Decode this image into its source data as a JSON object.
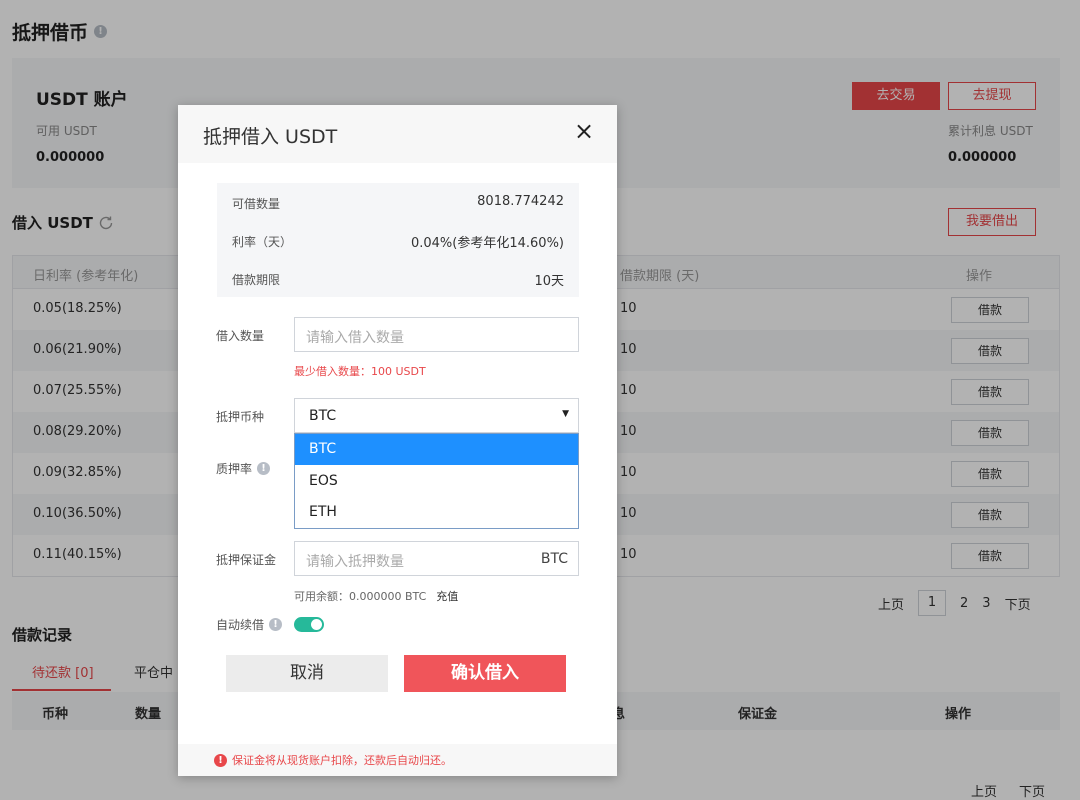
{
  "page": {
    "title": "抵押借币"
  },
  "account": {
    "title": "USDT 账户",
    "available_label": "可用 USDT",
    "available_value": "0.000000",
    "interest_label": "累计利息 USDT",
    "interest_value": "0.000000",
    "trade_button": "去交易",
    "withdraw_button": "去提现"
  },
  "borrow": {
    "title": "借入 USDT",
    "lend_button": "我要借出",
    "columns": [
      "日利率 (参考年化)",
      "借款期限 (天)",
      "操作"
    ],
    "rows": [
      {
        "rate": "0.05(18.25%)",
        "term": "10",
        "action": "借款"
      },
      {
        "rate": "0.06(21.90%)",
        "term": "10",
        "action": "借款"
      },
      {
        "rate": "0.07(25.55%)",
        "term": "10",
        "action": "借款"
      },
      {
        "rate": "0.08(29.20%)",
        "term": "10",
        "action": "借款"
      },
      {
        "rate": "0.09(32.85%)",
        "term": "10",
        "action": "借款"
      },
      {
        "rate": "0.10(36.50%)",
        "term": "10",
        "action": "借款"
      },
      {
        "rate": "0.11(40.15%)",
        "term": "10",
        "action": "借款"
      }
    ],
    "pager": {
      "prev": "上页",
      "pages": [
        "1",
        "2",
        "3"
      ],
      "current": "1",
      "next": "下页"
    }
  },
  "records": {
    "title": "借款记录",
    "tabs": [
      "待还款 [0]",
      "平仓中"
    ],
    "columns": [
      "币种",
      "数量",
      "息",
      "保证金",
      "操作"
    ],
    "pager": {
      "prev": "上页",
      "next": "下页"
    }
  },
  "modal": {
    "title": "抵押借入 USDT",
    "close_icon": "×",
    "summary": [
      {
        "label": "可借数量",
        "value": "8018.774242"
      },
      {
        "label": "利率（天）",
        "value": "0.04%(参考年化14.60%)"
      },
      {
        "label": "借款期限",
        "value": "10天"
      }
    ],
    "amount_label": "借入数量",
    "amount_placeholder": "请输入借入数量",
    "min_hint": "最少借入数量：100 USDT",
    "collateral_label": "抵押币种",
    "collateral_selected": "BTC",
    "collateral_options": [
      "BTC",
      "EOS",
      "ETH"
    ],
    "pledge_rate_label": "质押率",
    "margin_label": "抵押保证金",
    "margin_placeholder": "请输入抵押数量",
    "margin_unit": "BTC",
    "available_balance": "可用余额：0.000000 BTC",
    "deposit_link": "充值",
    "auto_renew_label": "自动续借",
    "auto_renew_on": true,
    "cancel_button": "取消",
    "confirm_button": "确认借入",
    "footer_note": "保证金将从现货账户扣除，还款后自动归还。"
  },
  "colors": {
    "accent_red": "#e8474a",
    "confirm_red": "#f0555a",
    "toggle_green": "#26b99a",
    "select_blue": "#1e90ff"
  }
}
